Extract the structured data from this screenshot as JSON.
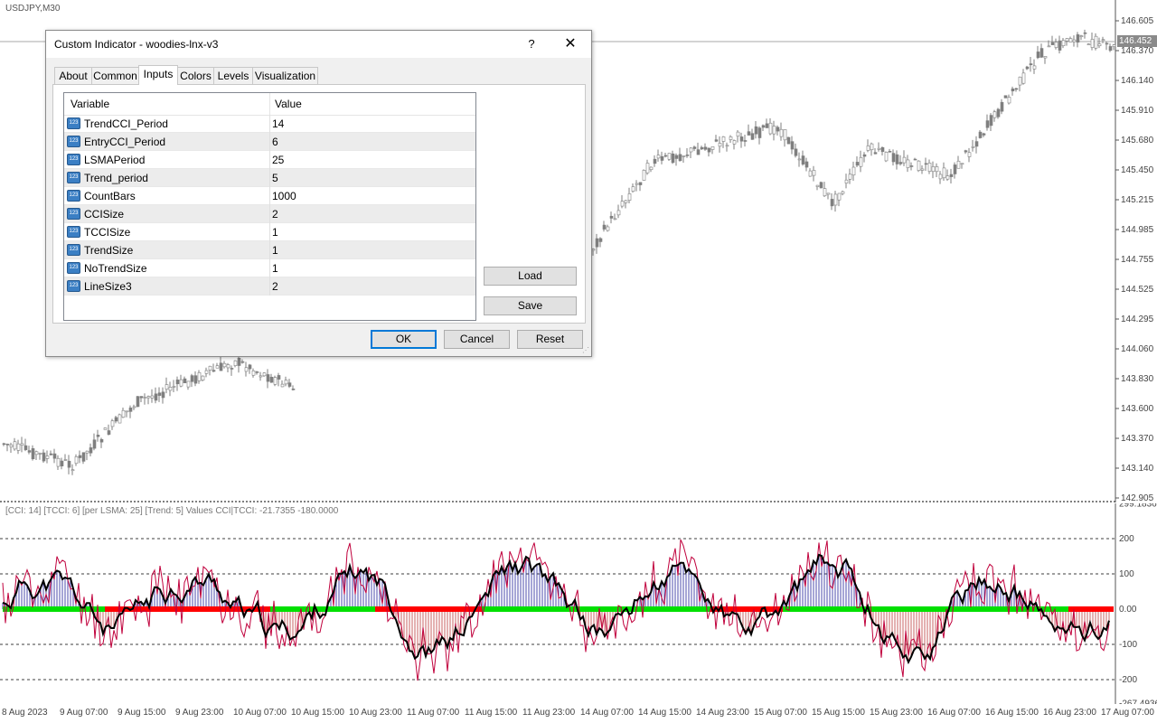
{
  "chart": {
    "symbol": "USDJPY,M30",
    "current_price": "146.452",
    "price_ticks": [
      "146.605",
      "146.370",
      "146.140",
      "145.910",
      "145.680",
      "145.450",
      "145.215",
      "144.985",
      "144.755",
      "144.525",
      "144.295",
      "144.060",
      "143.830",
      "143.600",
      "143.370",
      "143.140",
      "142.905"
    ],
    "indicator_label": "[CCI: 14] [TCCI: 6] [per LSMA: 25] [Trend: 5] Values CCI|TCCI: -21.7355 -180.0000",
    "indicator_ticks": [
      "299.1836",
      "200",
      "100",
      "0.00",
      "-100",
      "-200",
      "-267.4936"
    ],
    "time_labels": [
      "8 Aug 2023",
      "9 Aug 07:00",
      "9 Aug 15:00",
      "9 Aug 23:00",
      "10 Aug 07:00",
      "10 Aug 15:00",
      "10 Aug 23:00",
      "11 Aug 07:00",
      "11 Aug 15:00",
      "11 Aug 23:00",
      "14 Aug 07:00",
      "14 Aug 15:00",
      "14 Aug 23:00",
      "15 Aug 07:00",
      "15 Aug 15:00",
      "15 Aug 23:00",
      "16 Aug 07:00",
      "16 Aug 15:00",
      "16 Aug 23:00",
      "17 Aug 07:00"
    ],
    "colors": {
      "up_trend": "#00e000",
      "down_trend": "#ff0000",
      "cci_line": "#000000",
      "tcci_line": "#c0003c",
      "histogram": "#00008b",
      "candles": "#7f7f7f"
    }
  },
  "dialog": {
    "title": "Custom Indicator - woodies-lnx-v3",
    "help": "?",
    "close": "✕",
    "tabs": [
      "About",
      "Common",
      "Inputs",
      "Colors",
      "Levels",
      "Visualization"
    ],
    "active_tab": "Inputs",
    "columns": {
      "variable": "Variable",
      "value": "Value"
    },
    "params": [
      {
        "name": "TrendCCI_Period",
        "value": "14"
      },
      {
        "name": "EntryCCI_Period",
        "value": "6"
      },
      {
        "name": "LSMAPeriod",
        "value": "25"
      },
      {
        "name": "Trend_period",
        "value": "5"
      },
      {
        "name": "CountBars",
        "value": "1000"
      },
      {
        "name": "CCISize",
        "value": "2"
      },
      {
        "name": "TCCISize",
        "value": "1"
      },
      {
        "name": "TrendSize",
        "value": "1"
      },
      {
        "name": "NoTrendSize",
        "value": "1"
      },
      {
        "name": "LineSize3",
        "value": "2"
      }
    ],
    "param_icon": "123",
    "buttons": {
      "load": "Load",
      "save": "Save",
      "ok": "OK",
      "cancel": "Cancel",
      "reset": "Reset"
    }
  }
}
